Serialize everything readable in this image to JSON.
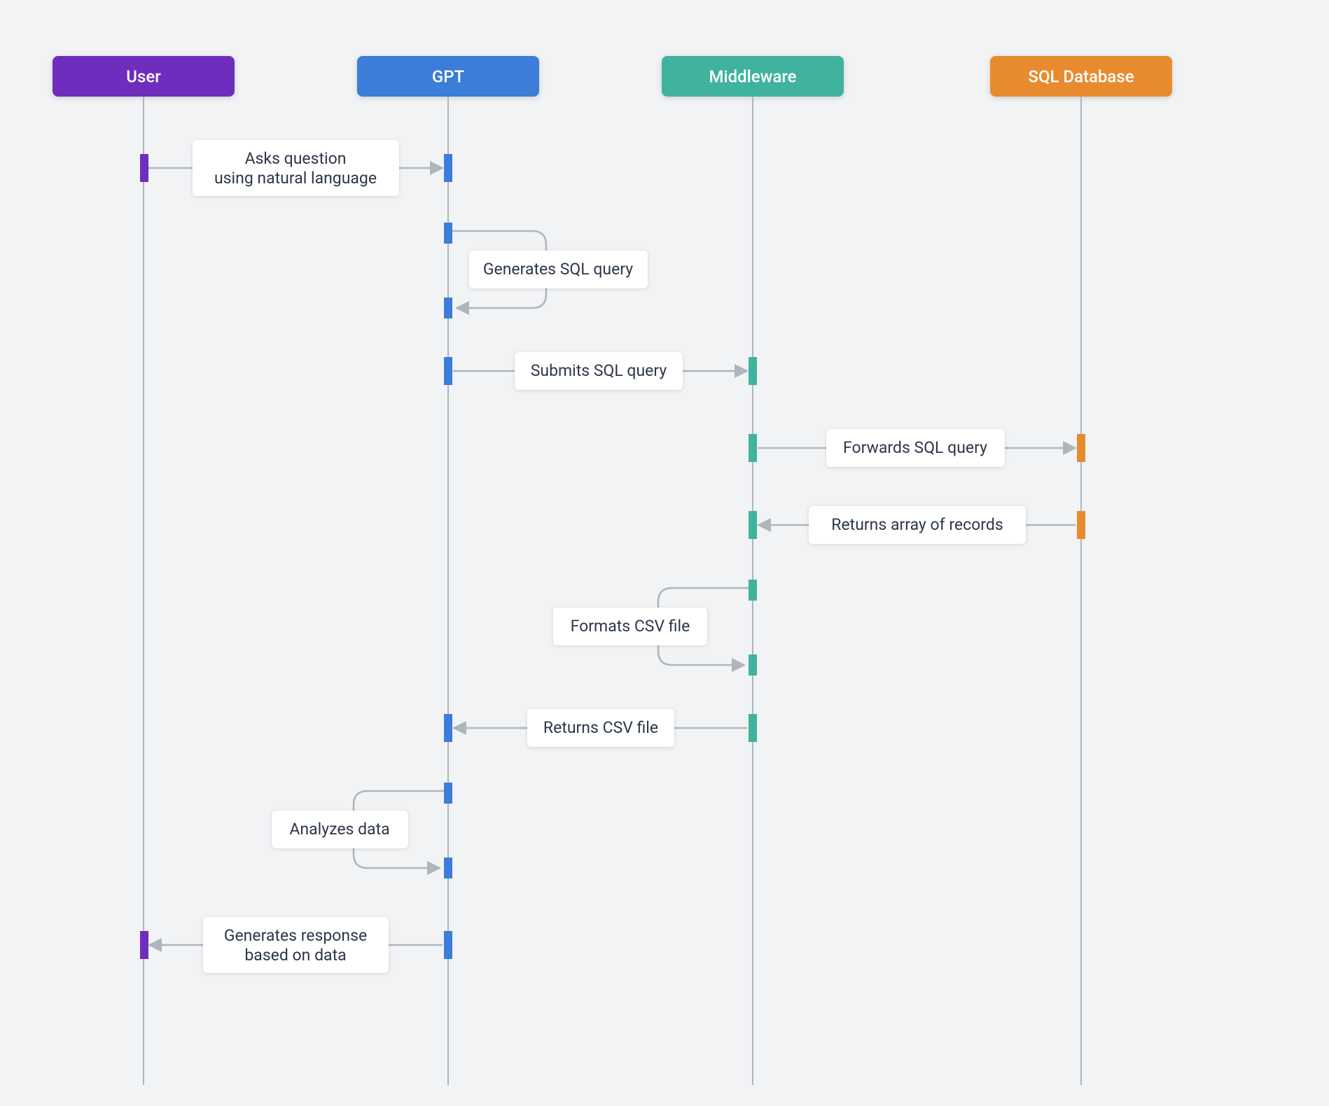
{
  "diagram": {
    "type": "sequence",
    "participants": [
      {
        "id": "user",
        "label": "User",
        "color": "#6f2dbd"
      },
      {
        "id": "gpt",
        "label": "GPT",
        "color": "#3b7dd8"
      },
      {
        "id": "mw",
        "label": "Middleware",
        "color": "#3fb39d"
      },
      {
        "id": "db",
        "label": "SQL Database",
        "color": "#e88b2e"
      }
    ],
    "messages": [
      {
        "id": "m1",
        "from": "user",
        "to": "gpt",
        "label_lines": [
          "Asks question",
          "using natural language"
        ]
      },
      {
        "id": "m2",
        "from": "gpt",
        "to": "gpt",
        "label_lines": [
          "Generates SQL query"
        ]
      },
      {
        "id": "m3",
        "from": "gpt",
        "to": "mw",
        "label_lines": [
          "Submits SQL query"
        ]
      },
      {
        "id": "m4",
        "from": "mw",
        "to": "db",
        "label_lines": [
          "Forwards SQL query"
        ]
      },
      {
        "id": "m5",
        "from": "db",
        "to": "mw",
        "label_lines": [
          "Returns array of records"
        ]
      },
      {
        "id": "m6",
        "from": "mw",
        "to": "mw",
        "label_lines": [
          "Formats CSV file"
        ]
      },
      {
        "id": "m7",
        "from": "mw",
        "to": "gpt",
        "label_lines": [
          "Returns CSV file"
        ]
      },
      {
        "id": "m8",
        "from": "gpt",
        "to": "gpt",
        "label_lines": [
          "Analyzes data"
        ]
      },
      {
        "id": "m9",
        "from": "gpt",
        "to": "user",
        "label_lines": [
          "Generates response",
          "based on data"
        ]
      }
    ]
  }
}
